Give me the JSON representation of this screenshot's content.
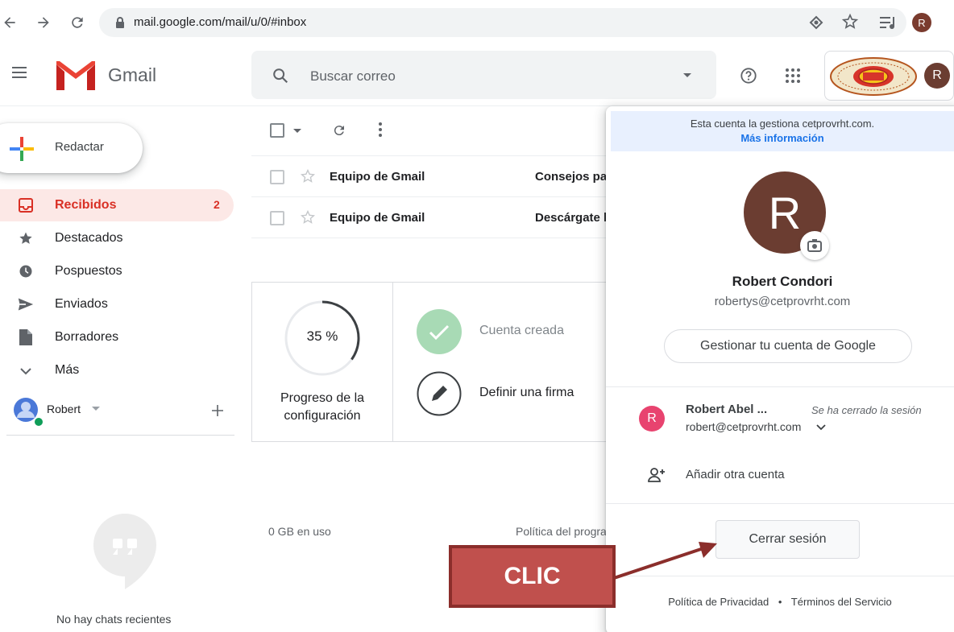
{
  "browser": {
    "url_host": "mail.google.com",
    "url_path": "/mail/u/0/#inbox",
    "profile_initial": "R"
  },
  "gmail": {
    "brand": "Gmail",
    "search_placeholder": "Buscar correo",
    "header_avatar_initial": "R"
  },
  "sidebar": {
    "compose_label": "Redactar",
    "items": [
      {
        "label": "Recibidos",
        "count": "2",
        "icon": "inbox-icon"
      },
      {
        "label": "Destacados",
        "icon": "star-icon"
      },
      {
        "label": "Pospuestos",
        "icon": "clock-icon"
      },
      {
        "label": "Enviados",
        "icon": "send-icon"
      },
      {
        "label": "Borradores",
        "icon": "draft-icon"
      },
      {
        "label": "Más",
        "icon": "chevron-down-icon"
      }
    ],
    "hangouts_user": "Robert",
    "no_chats": "No hay chats recientes"
  },
  "mail_list": {
    "rows": [
      {
        "sender": "Equipo de Gmail",
        "subject": "Consejos para usar tu nueva bandeja de entrada"
      },
      {
        "sender": "Equipo de Gmail",
        "subject": "Descárgate la aplicación oficial de Gmail"
      }
    ]
  },
  "setup": {
    "progress": "35 %",
    "progress_fraction": 0.35,
    "title": "Progreso de la configuración",
    "steps": [
      {
        "label": "Cuenta creada",
        "done": true
      },
      {
        "label": "Definir una firma",
        "done": false
      }
    ]
  },
  "footer": {
    "storage": "0 GB en uso",
    "policy": "Política del programa"
  },
  "account_panel": {
    "managed_text": "Esta cuenta la gestiona cetprovrht.com.",
    "managed_link": "Más información",
    "avatar_initial": "R",
    "name": "Robert Condori",
    "email": "robertys@cetprovrht.com",
    "manage_button": "Gestionar tu cuenta de Google",
    "other_account": {
      "initial": "R",
      "name": "Robert Abel ...",
      "status": "Se ha cerrado la sesión",
      "email": "robert@cetprovrht.com"
    },
    "add_account": "Añadir otra cuenta",
    "signout_button": "Cerrar sesión",
    "privacy": "Política de Privacidad",
    "separator": "•",
    "terms": "Términos del Servicio"
  },
  "annotation": {
    "label": "CLIC"
  },
  "colors": {
    "gmail_red": "#d93025",
    "link_blue": "#1a73e8",
    "annotation_fill": "#c0504d",
    "annotation_border": "#8b2e2b"
  }
}
